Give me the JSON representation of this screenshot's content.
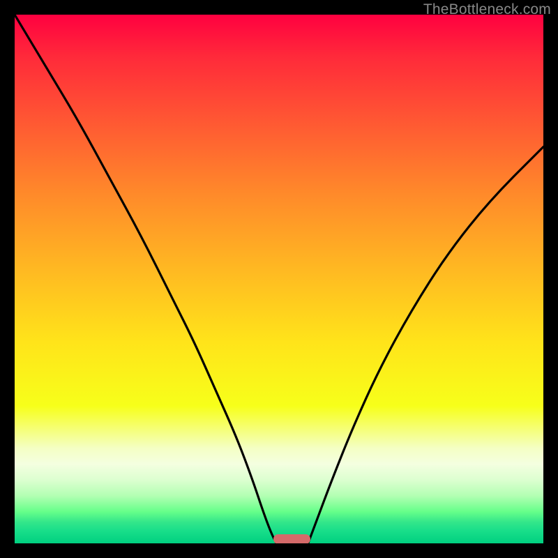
{
  "watermark": "TheBottleneck.com",
  "chart_data": {
    "type": "line",
    "title": "",
    "xlabel": "",
    "ylabel": "",
    "xlim": [
      0,
      100
    ],
    "ylim": [
      0,
      100
    ],
    "grid": false,
    "background": {
      "type": "vertical-gradient",
      "stops": [
        {
          "pos": 0,
          "color": "#ff0040"
        },
        {
          "pos": 20,
          "color": "#ff5733"
        },
        {
          "pos": 48,
          "color": "#ffb822"
        },
        {
          "pos": 74,
          "color": "#f7ff1a"
        },
        {
          "pos": 85,
          "color": "#f4ffe0"
        },
        {
          "pos": 94,
          "color": "#66ff8a"
        },
        {
          "pos": 100,
          "color": "#00d080"
        }
      ]
    },
    "series": [
      {
        "name": "left-curve",
        "x": [
          0,
          6,
          12,
          18,
          24,
          30,
          34,
          38,
          42,
          45,
          47,
          48.5,
          49.5
        ],
        "values": [
          100,
          90,
          80,
          69,
          58,
          46,
          38,
          29,
          20,
          12,
          6,
          2,
          0
        ]
      },
      {
        "name": "right-curve",
        "x": [
          55.5,
          57,
          60,
          64,
          69,
          75,
          82,
          90,
          100
        ],
        "values": [
          0,
          4,
          12,
          22,
          33,
          44,
          55,
          65,
          75
        ]
      }
    ],
    "marker": {
      "name": "bottleneck-marker",
      "x_range": [
        49,
        56
      ],
      "y": 0.8,
      "color": "#d56a6a"
    }
  }
}
